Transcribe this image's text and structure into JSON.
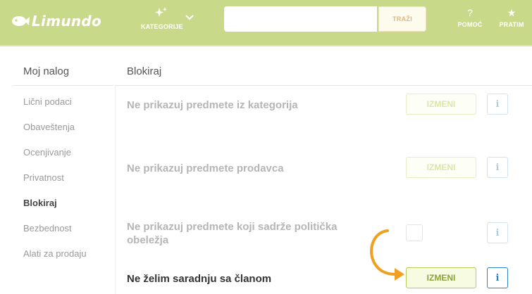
{
  "header": {
    "logo_text": "Limundo",
    "categories_label": "KATEGORIJE",
    "search_placeholder": "",
    "search_button": "TRAŽI",
    "help_icon": "?",
    "help_label": "POMOĆ",
    "follow_icon": "★",
    "follow_label": "PRATIM",
    "colors": {
      "bar": "#c9d98a",
      "search_button_text": "#e3b67a"
    }
  },
  "sidebar": {
    "title": "Moj nalog",
    "items": [
      {
        "label": "Lični podaci",
        "active": false
      },
      {
        "label": "Obaveštenja",
        "active": false
      },
      {
        "label": "Ocenjivanje",
        "active": false
      },
      {
        "label": "Privatnost",
        "active": false
      },
      {
        "label": "Blokiraj",
        "active": true
      },
      {
        "label": "Bezbednost",
        "active": false
      },
      {
        "label": "Alati za prodaju",
        "active": false
      }
    ]
  },
  "main": {
    "title": "Blokiraj",
    "rows": [
      {
        "label": "Ne prikazuj predmete iz kategorija",
        "button": "IZMENI",
        "info": "i"
      },
      {
        "label": "Ne prikazuj predmete prodavca",
        "button": "IZMENI",
        "info": "i"
      },
      {
        "label_line1": "Ne prikazuj predmete koji sadrže politička",
        "label_line2": "obeležja",
        "checked": false,
        "info": "i"
      },
      {
        "label": "Ne želim saradnju sa članom",
        "button": "IZMENI",
        "info": "i",
        "highlighted": true
      }
    ],
    "colors": {
      "active_button_border": "#b7cc5f",
      "info_active": "#2f83c4",
      "arrow": "#f0a020"
    }
  }
}
